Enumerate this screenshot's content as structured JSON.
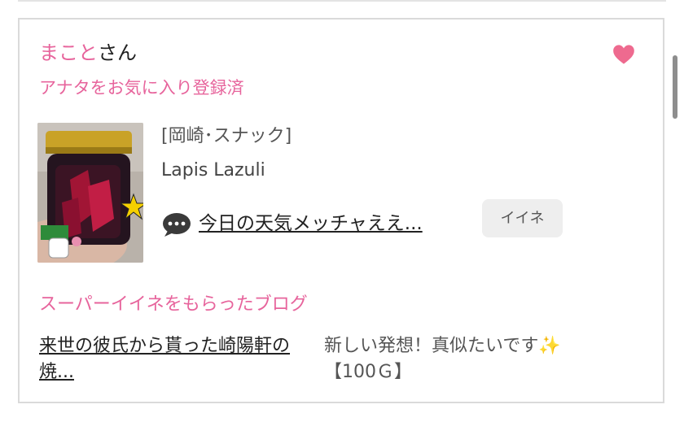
{
  "user": {
    "name": "まこと",
    "suffix": "さん",
    "favorite_status": "アナタをお気に入り登録済"
  },
  "shop": {
    "area": "[岡崎･スナック]",
    "name": "Lapis Lazuli"
  },
  "latest_blog": {
    "title": "今日の天気メッチャええ...",
    "like_label": "イイネ"
  },
  "super_like": {
    "heading": "スーパーイイネをもらったブログ",
    "blog_title": "来世の彼氏から貰った崎陽軒の焼...",
    "comment": "新しい発想！真似たいです",
    "sparkle": "✨",
    "points": "【100Ｇ】"
  },
  "icons": {
    "heart": "heart-icon",
    "bubble": "speech-bubble-icon"
  },
  "colors": {
    "accent": "#e7649c",
    "heart": "#ee6a8f",
    "button_bg": "#eeeeee",
    "border": "#dadada"
  }
}
